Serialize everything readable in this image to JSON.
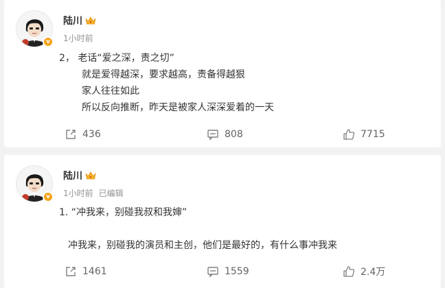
{
  "posts": [
    {
      "username": "陆川",
      "time": "1小时前",
      "edited": "",
      "lines": [
        "2， 老话“爱之深，责之切”",
        "就是爱得越深，要求越高，责备得越狠",
        "家人往往如此",
        "所以反向推断，昨天是被家人深深爱着的一天"
      ],
      "shares": "436",
      "comments": "808",
      "likes": "7715"
    },
    {
      "username": "陆川",
      "time": "1小时前",
      "edited": "已编辑",
      "lines": [
        "1. “冲我来，别碰我叔和我婶”",
        "",
        "冲我来，别碰我的演员和主创，他们是最好的，有什么事冲我来"
      ],
      "shares": "1461",
      "comments": "1559",
      "likes": "2.4万"
    }
  ],
  "icons": {
    "share": "share-icon",
    "comment": "comment-icon",
    "like": "thumbs-up-icon",
    "crown": "crown-badge-icon",
    "verified": "verified-v-icon"
  },
  "colors": {
    "background": "#f2f2f2",
    "card": "#ffffff",
    "meta": "#939393",
    "verified": "#f6a319"
  }
}
